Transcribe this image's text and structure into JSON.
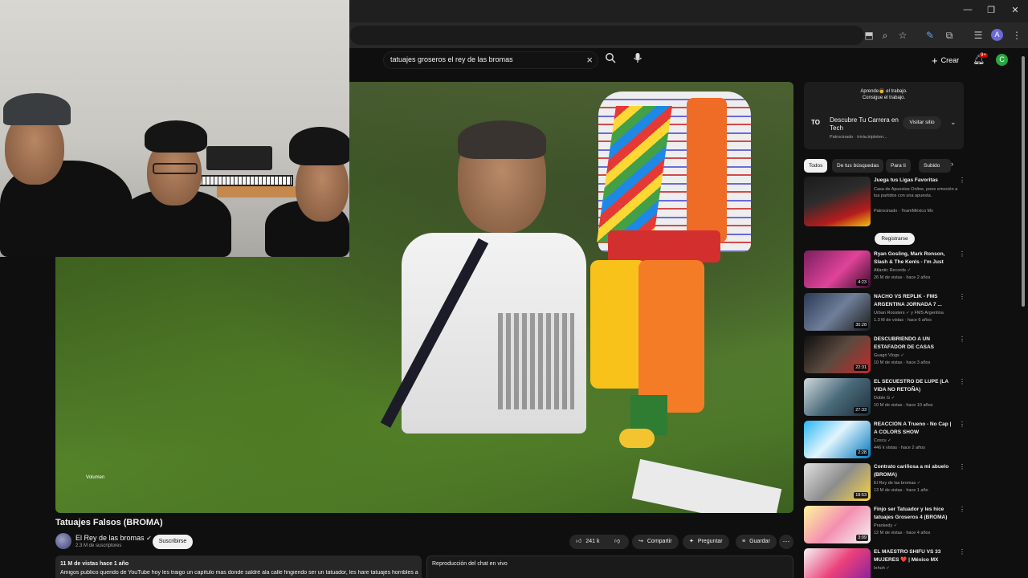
{
  "browser": {
    "window_controls": [
      "—",
      "❐",
      "✕"
    ],
    "profile_initial": "A"
  },
  "header": {
    "search_query": "tatuajes groseros el rey de las bromas",
    "create_label": "Crear",
    "notifications_badge": "9+",
    "avatar_initial": "C"
  },
  "player": {
    "volume_label": "Volumen"
  },
  "video": {
    "title": "Tatuajes Falsos (BROMA)",
    "channel": "El Rey de las bromas",
    "subscribers": "2.3 M de suscriptores",
    "subscribe_label": "Suscribirse",
    "likes": "241 k",
    "share_label": "Compartir",
    "ask_label": "Preguntar",
    "save_label": "Guardar",
    "views_date": "11 M de vistas  hace 1 año",
    "description": "Amigos publico querido de YouTube hoy les traigo un capítulo mas donde saldré ala calle fingiendo ser un tatuador, les hare tatuajes horribles a",
    "chat_title": "Reproducción del chat en vivo"
  },
  "ad": {
    "tagline_1": "Aprende👨 el trabajo.",
    "tagline_2": "Consigue el trabajo.",
    "title": "Descubre Tu Carrera en Tech",
    "sponsor": "Patrocinado · trivia.tripleten...",
    "visit_label": "Visitar sitio",
    "logo": "TO"
  },
  "chips": [
    "Todos",
    "De tus búsquedas",
    "Para ti",
    "Subido"
  ],
  "recommendations": [
    {
      "title": "Juega tus Ligas Favoritas",
      "channel": "Casa de Apuestas Online, pone emoción a tus partidos con una apuesta.",
      "meta": "Patrocinado · TeamMéxico Mx",
      "duration": "",
      "cta": "Registrarse"
    },
    {
      "title": "Ryan Gosling, Mark Ronson, Slash & The Kenls - I'm Just Ke...",
      "channel": "Atlantic Records ✓",
      "meta": "26 M de vistas · hace 2 años",
      "duration": "4:23"
    },
    {
      "title": "NACHO VS REPLIK - FMS ARGENTINA JORNADA 7 ...",
      "channel": "Urban Roosters ✓ y FMS Argentina",
      "meta": "1.3 M de vistas · hace 6 años",
      "duration": "30:28"
    },
    {
      "title": "DESCUBRIENDO A UN ESTAFADOR DE CASAS",
      "channel": "Guagri Vlogs ✓",
      "meta": "10 M de vistas · hace 3 años",
      "duration": "22:31"
    },
    {
      "title": "EL SECUESTRO DE LUPE (LA VIDA NO RETOÑA)",
      "channel": "Doble G ✓",
      "meta": "10 M de vistas · hace 10 años",
      "duration": "27:33"
    },
    {
      "title": "REACCION A Trueno - No Cap | A COLORS SHOW",
      "channel": "Coscu ✓",
      "meta": "446 k vistas · hace 2 años",
      "duration": "2:28"
    },
    {
      "title": "Contrato cariñosa a mi abuelo (BROMA)",
      "channel": "El Rey de las bromas ✓",
      "meta": "13 M de vistas · hace 1 año",
      "duration": "18:53"
    },
    {
      "title": "Finjo ser Tatuador y les hice tatuajes Groseros 4 (BROMA)",
      "channel": "Prankedy ✓",
      "meta": "12 M de vistas · hace 4 años",
      "duration": "3:09"
    },
    {
      "title": "EL MAESTRO SHIFU VS 33 MUJERES ❤️ | México MX",
      "channel": "Iehuh ✓",
      "meta": "",
      "duration": ""
    }
  ],
  "colors": {
    "background": "#0f0f0f",
    "surface": "#272727",
    "text": "#f1f1f1",
    "muted": "#aaaaaa",
    "notification": "#cc0000",
    "avatar_green": "#2ba640"
  }
}
